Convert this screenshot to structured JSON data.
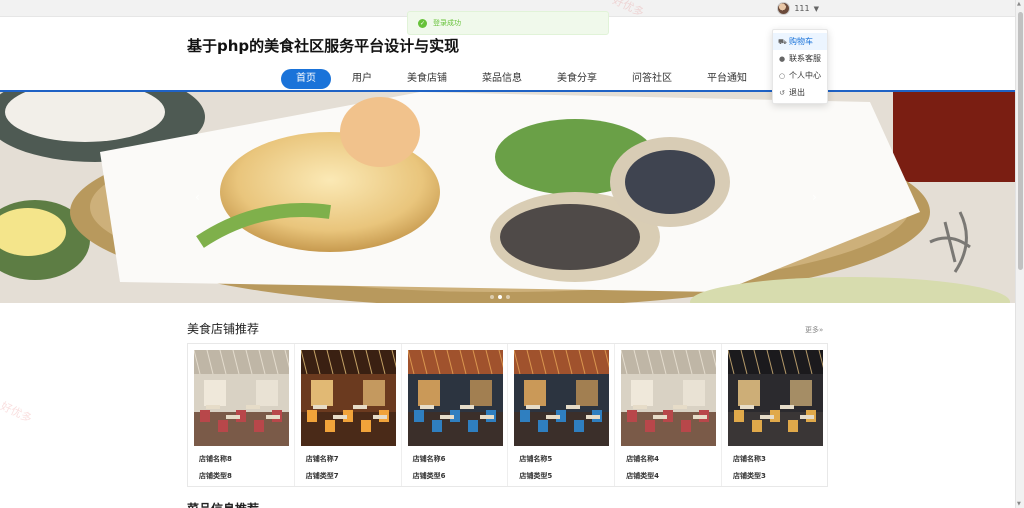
{
  "header": {
    "user_name": "111",
    "site_title": "基于php的美食社区服务平台设计与实现"
  },
  "toast": {
    "message": "登录成功"
  },
  "nav": {
    "items": [
      {
        "label": "首页",
        "active": true
      },
      {
        "label": "用户",
        "active": false
      },
      {
        "label": "美食店铺",
        "active": false
      },
      {
        "label": "菜品信息",
        "active": false
      },
      {
        "label": "美食分享",
        "active": false
      },
      {
        "label": "问答社区",
        "active": false
      },
      {
        "label": "平台通知",
        "active": false
      }
    ]
  },
  "user_menu": {
    "items": [
      {
        "label": "购物车",
        "icon": "cart-icon"
      },
      {
        "label": "联系客服",
        "icon": "person-icon"
      },
      {
        "label": "个人中心",
        "icon": "user-outline-icon"
      },
      {
        "label": "退出",
        "icon": "logout-icon"
      }
    ]
  },
  "banner": {
    "slide_count": 3,
    "active_slide": 1
  },
  "stores_section": {
    "title": "美食店铺推荐",
    "more": "更多»",
    "stores": [
      {
        "name": "店铺名称8",
        "type": "店铺类型8",
        "theme": "bright"
      },
      {
        "name": "店铺名称7",
        "type": "店铺类型7",
        "theme": "warm"
      },
      {
        "name": "店铺名称6",
        "type": "店铺类型6",
        "theme": "hall"
      },
      {
        "name": "店铺名称5",
        "type": "店铺类型5",
        "theme": "hall"
      },
      {
        "name": "店铺名称4",
        "type": "店铺类型4",
        "theme": "bright"
      },
      {
        "name": "店铺名称3",
        "type": "店铺类型3",
        "theme": "night"
      }
    ]
  },
  "next_section": {
    "title": "菜品信息推荐"
  },
  "watermark": "好优多",
  "colors": {
    "primary": "#1a73d9",
    "nav_line": "#1f62c5",
    "toast_green": "#67c23a"
  }
}
